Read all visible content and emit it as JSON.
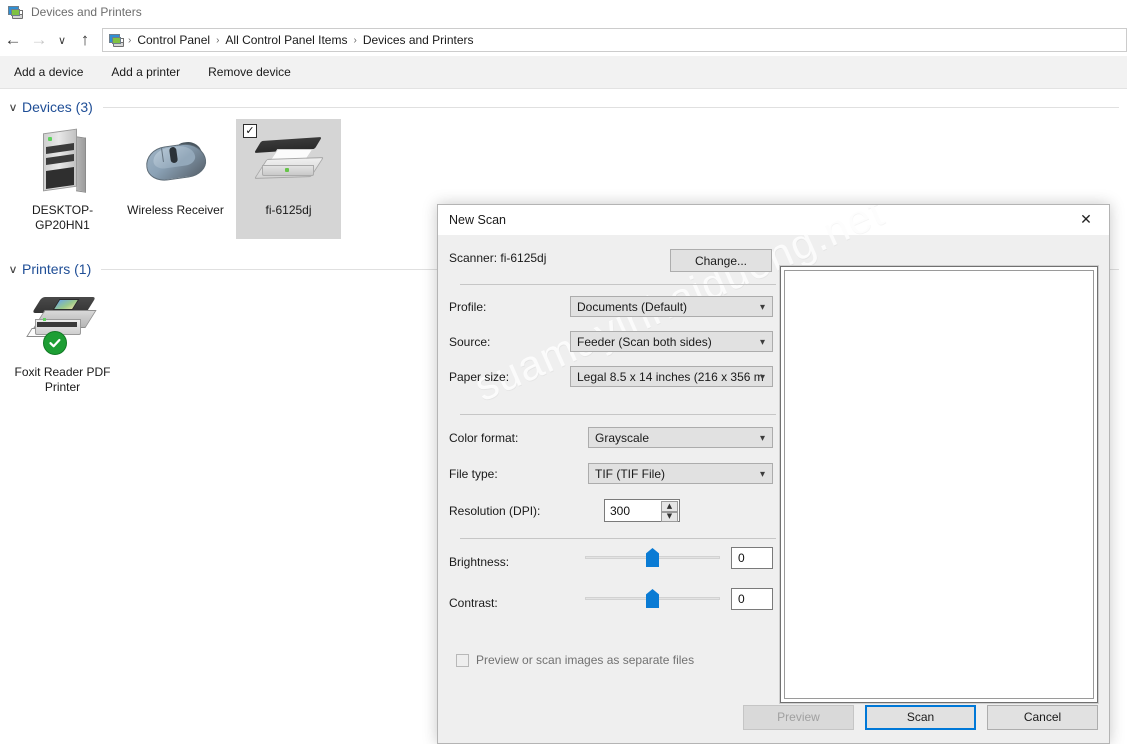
{
  "window": {
    "title": "Devices and Printers",
    "icon": "devices-and-printers-icon"
  },
  "nav": {
    "back_icon": "←",
    "forward_icon": "→",
    "recent_icon": "∨",
    "up_icon": "↑",
    "breadcrumbs": [
      "Control Panel",
      "All Control Panel Items",
      "Devices and Printers"
    ],
    "separator": "›"
  },
  "commandbar": {
    "items": [
      "Add a device",
      "Add a printer",
      "Remove device"
    ]
  },
  "groups": [
    {
      "title": "Devices (3)",
      "chevron": "∨",
      "items": [
        {
          "label": "DESKTOP-GP20HN1",
          "icon": "computer-tower-icon",
          "selected": false,
          "checked": false
        },
        {
          "label": "Wireless Receiver",
          "icon": "mouse-icon",
          "selected": false,
          "checked": false
        },
        {
          "label": "fi-6125dj",
          "icon": "scanner-icon",
          "selected": true,
          "checked": true
        }
      ]
    },
    {
      "title": "Printers (1)",
      "chevron": "∨",
      "items": [
        {
          "label": "Foxit Reader PDF Printer",
          "icon": "printer-icon",
          "selected": false,
          "checked": false,
          "badge": "default-printer-check-icon"
        }
      ]
    }
  ],
  "dialog": {
    "title": "New Scan",
    "close_icon": "✕",
    "watermark": "suamayinhaiduong.net",
    "scanner_label": "Scanner: fi-6125dj",
    "change_button": "Change...",
    "fields": [
      {
        "label": "Profile:",
        "value": "Documents (Default)",
        "name": "profile"
      },
      {
        "label": "Source:",
        "value": "Feeder (Scan both sides)",
        "name": "source"
      },
      {
        "label": "Paper size:",
        "value": "Legal 8.5 x 14 inches (216 x 356 m",
        "name": "paper-size"
      },
      {
        "label": "Color format:",
        "value": "Grayscale",
        "name": "color-format"
      },
      {
        "label": "File type:",
        "value": "TIF (TIF File)",
        "name": "file-type"
      }
    ],
    "resolution": {
      "label": "Resolution (DPI):",
      "value": "300"
    },
    "brightness": {
      "label": "Brightness:",
      "value": "0"
    },
    "contrast": {
      "label": "Contrast:",
      "value": "0"
    },
    "separate_files": {
      "label": "Preview or scan images as separate files",
      "checked": false
    },
    "buttons": {
      "preview": "Preview",
      "scan": "Scan",
      "cancel": "Cancel"
    },
    "accent_color": "#0078d7"
  }
}
